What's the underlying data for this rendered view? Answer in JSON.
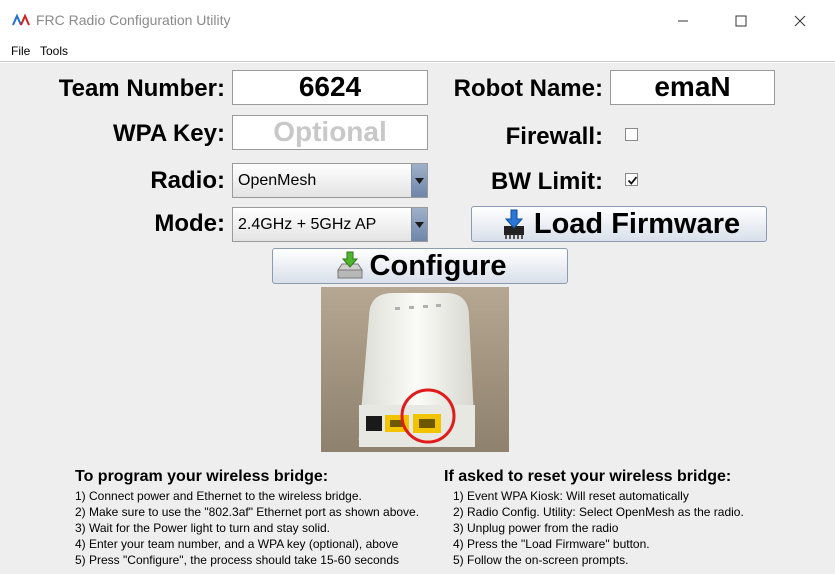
{
  "window": {
    "title": "FRC Radio Configuration Utility",
    "minimize_glyph": "—",
    "maximize_glyph": "☐",
    "close_glyph": "✕"
  },
  "menu": {
    "file": "File",
    "tools": "Tools"
  },
  "form": {
    "team_number_label": "Team Number:",
    "team_number_value": "6624",
    "robot_name_label": "Robot Name:",
    "robot_name_value": "emaN",
    "wpa_key_label": "WPA Key:",
    "wpa_key_placeholder": "Optional",
    "firewall_label": "Firewall:",
    "firewall_checked": false,
    "radio_label": "Radio:",
    "radio_value": "OpenMesh",
    "bw_limit_label": "BW Limit:",
    "bw_limit_checked": true,
    "mode_label": "Mode:",
    "mode_value": "2.4GHz + 5GHz AP"
  },
  "buttons": {
    "load_firmware": "Load Firmware",
    "configure": "Configure"
  },
  "instructions_program": {
    "title": "To program your wireless bridge:",
    "steps": [
      "1) Connect power and Ethernet to the wireless bridge.",
      "2) Make sure to use the \"802.3af\" Ethernet port as shown above.",
      "3) Wait for the Power light to turn and stay solid.",
      "4) Enter your team number, and a WPA key (optional), above",
      "5) Press \"Configure\", the process should take 15-60 seconds"
    ]
  },
  "instructions_reset": {
    "title": "If asked to reset your wireless bridge:",
    "steps": [
      "1) Event WPA Kiosk: Will reset automatically",
      "2) Radio Config. Utility: Select OpenMesh as the radio.",
      "3) Unplug power from the radio",
      "4) Press the \"Load Firmware\" button.",
      "5) Follow the on-screen prompts."
    ]
  },
  "colors": {
    "panel_background": "#eeeeee",
    "button_border": "#8d9bb0",
    "highlight_circle": "#e01b1b",
    "port_yellow": "#f2c400"
  },
  "icons": {
    "app": "frc-logo-icon",
    "firmware": "chip-download-icon",
    "configure": "drive-download-icon",
    "combo": "chevron-down-icon"
  }
}
